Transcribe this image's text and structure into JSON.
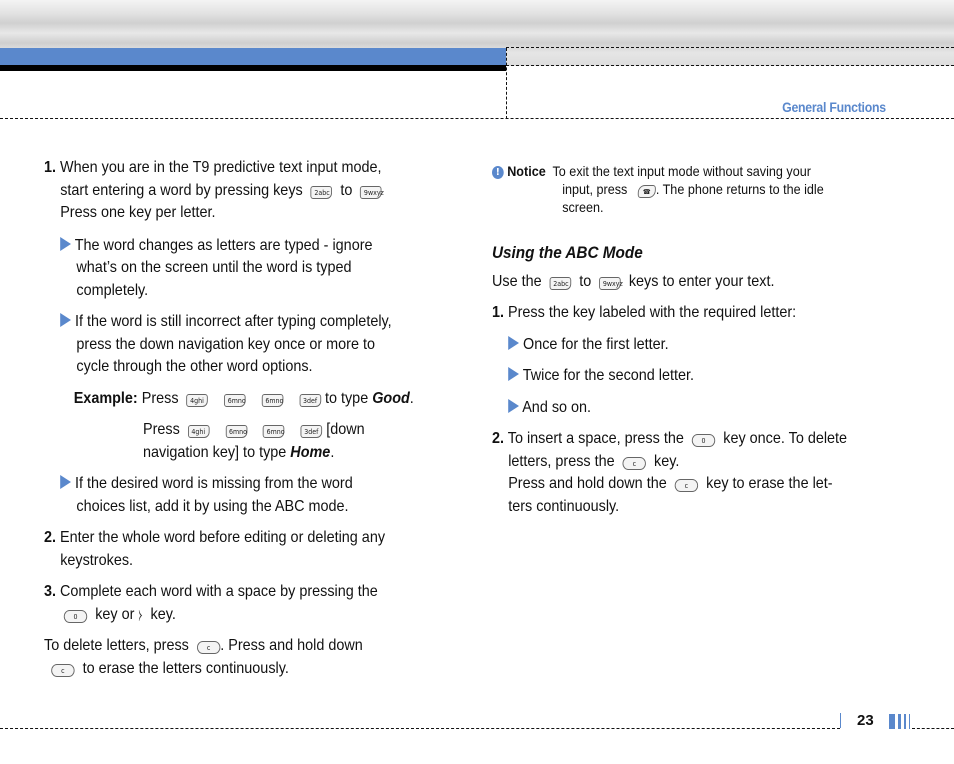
{
  "header": {
    "section_title": "General Functions",
    "accent_color": "#5a88cc"
  },
  "left": {
    "step1": {
      "num": "1.",
      "line1": "When you are in the T9 predictive text input mode,",
      "line2a": "start entering a word by pressing keys",
      "key_from": "2abc",
      "to": "to",
      "key_to": "9wxyz",
      "line3": "Press one key per letter."
    },
    "bullet1": [
      "The word changes as letters are typed - ignore",
      "what’s on the screen until the word is typed",
      "completely."
    ],
    "bullet2": [
      "If the word is still incorrect after typing completely,",
      "press the down navigation key once or more to",
      "cycle through the other word options."
    ],
    "example": {
      "label": "Example:",
      "press": "Press",
      "keys_good": [
        "4ghi",
        "6mno",
        "6mno",
        "3def"
      ],
      "to_type": "to type",
      "word_good": "Good",
      "period": ".",
      "keys_home": [
        "4ghi",
        "6mno",
        "6mno",
        "3def"
      ],
      "down_nav": "[down",
      "line3a": "navigation key] to type",
      "word_home": "Home"
    },
    "bullet3": [
      "If the desired word is missing from the word",
      "choices list, add it by using the ABC mode."
    ],
    "step2": {
      "num": "2.",
      "lines": [
        "Enter the whole word before editing or deleting any",
        "keystrokes."
      ]
    },
    "step3": {
      "num": "3.",
      "line1": "Complete each word with a space by pressing the",
      "key_space": "0",
      "key_or": "key or",
      "key_end": "key."
    },
    "delete": {
      "line1a": "To delete letters, press",
      "key_c": "c",
      "line1b": ". Press and hold down",
      "line2": "to erase the letters continuously."
    }
  },
  "right": {
    "notice": {
      "icon": "!",
      "label": "Notice",
      "line1": "To exit the text input mode without saving your",
      "line2a": "input, press",
      "line2b": ". The phone returns to the idle",
      "line3": "screen."
    },
    "heading": "Using the ABC Mode",
    "intro": {
      "a": "Use the",
      "key_from": "2abc",
      "to": "to",
      "key_to": "9wxyz",
      "b": "keys to enter your text."
    },
    "step1": {
      "num": "1.",
      "text": "Press the key labeled with the required letter:"
    },
    "bullets": [
      "Once for the first letter.",
      "Twice for the second letter.",
      "And so on."
    ],
    "step2": {
      "num": "2.",
      "line1a": "To insert a space, press the",
      "key_space": "0",
      "line1b": "key once. To delete",
      "line2a": "letters, press the",
      "key_c": "c",
      "line2b": "key.",
      "line3a": "Press and hold down the",
      "line3b": "key to erase the let-",
      "line4": "ters continuously."
    }
  },
  "footer": {
    "page_number": "23"
  }
}
